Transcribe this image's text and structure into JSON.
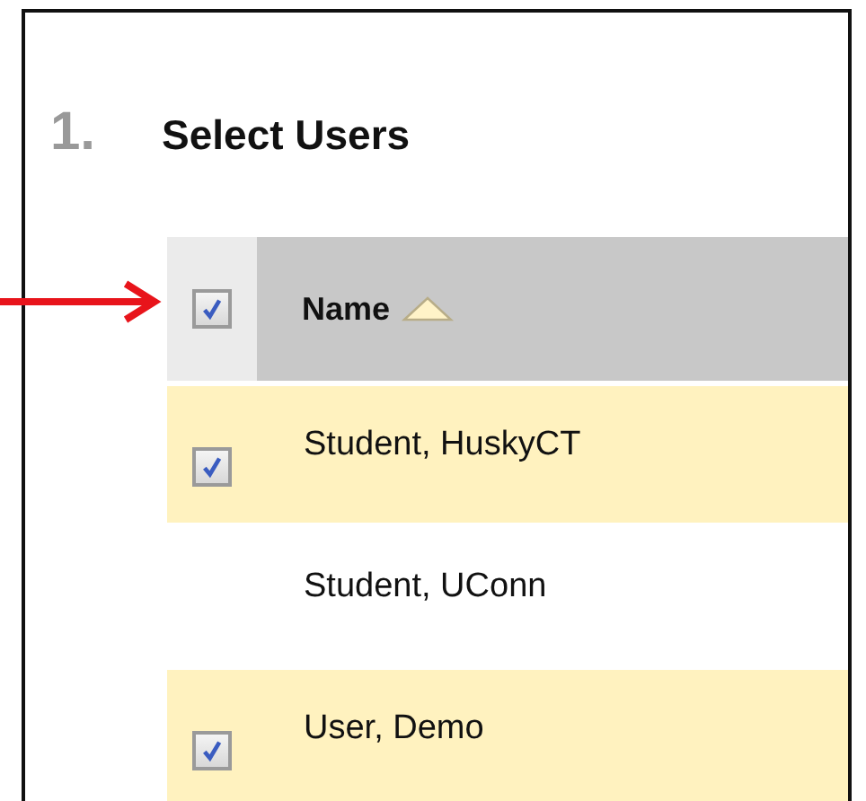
{
  "step": {
    "number": "1.",
    "title": "Select Users"
  },
  "table": {
    "header": {
      "checked": true,
      "column": "Name",
      "sorted_ascending": true
    },
    "rows": [
      {
        "name": "Student, HuskyCT",
        "checked": true
      },
      {
        "name": "Student, UConn",
        "checked": false
      },
      {
        "name": "User, Demo",
        "checked": true
      }
    ]
  },
  "annotation": {
    "kind": "arrow"
  }
}
